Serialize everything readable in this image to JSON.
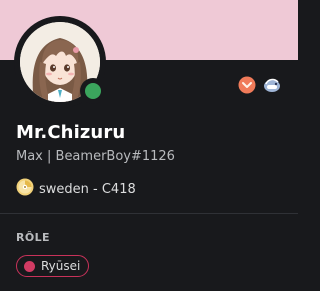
{
  "profile": {
    "display_name": "Mr.Chizuru",
    "subtitle": "Max | BeamerBoy#1126",
    "status": "online",
    "avatar_icon": "anime-girl-avatar",
    "badges": [
      "hypesquad-bravery-icon",
      "shark-nitro-icon"
    ]
  },
  "custom_status": {
    "emoji": "cd-disc-icon",
    "text": "sweden - C418"
  },
  "roles": {
    "title": "RÔLE",
    "items": [
      {
        "label": "Ryūsei",
        "color": "#d13b63"
      }
    ]
  },
  "colors": {
    "banner": "#efc9d6",
    "background": "#18191c",
    "online": "#3ba55d"
  }
}
